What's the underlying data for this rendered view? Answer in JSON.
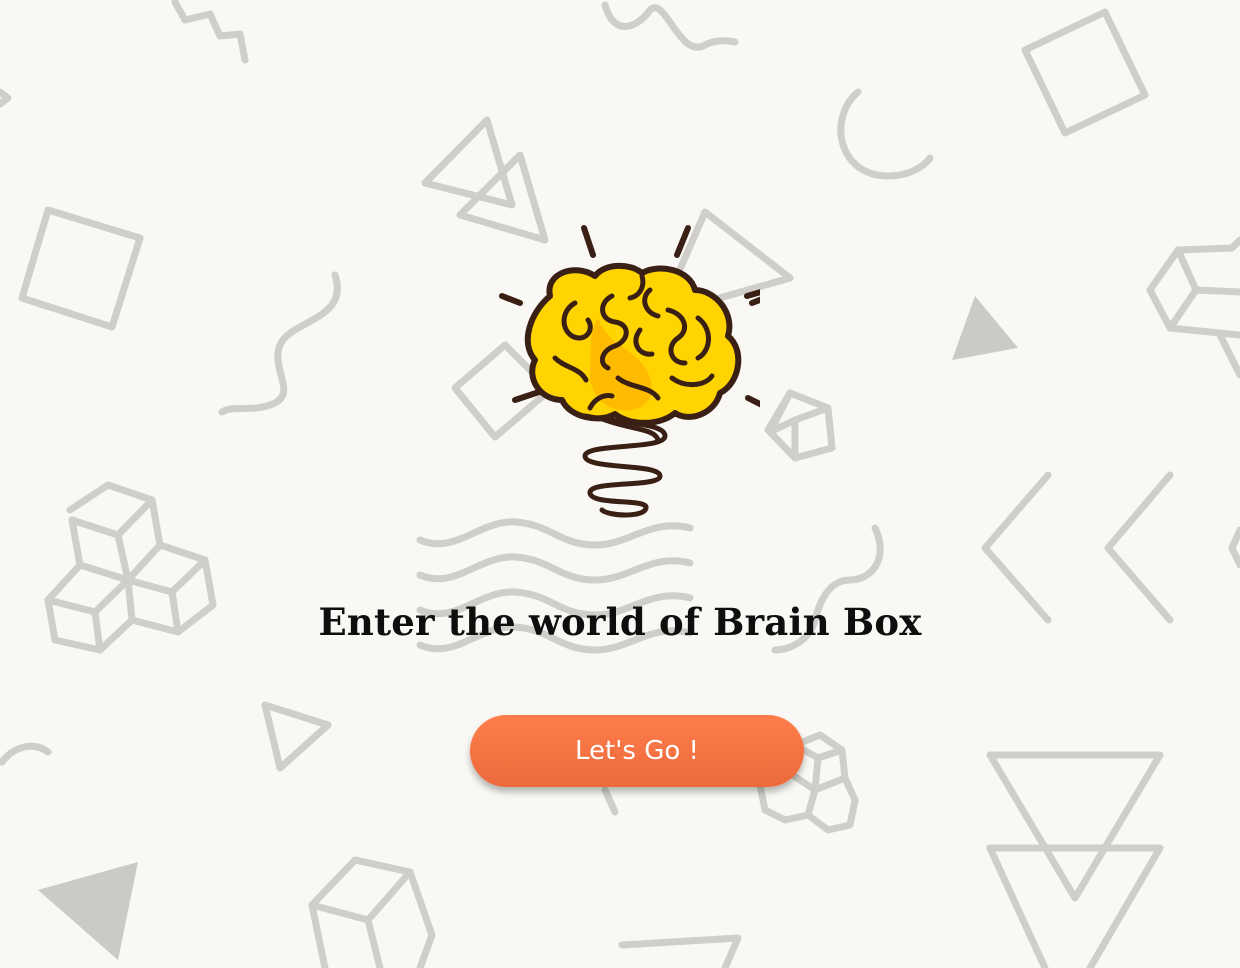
{
  "headline": "Enter the world of Brain Box",
  "cta_button": {
    "label": "Let's Go !"
  },
  "logo": {
    "icon": "brain-lightbulb-icon"
  },
  "colors": {
    "background": "#f9f8f4",
    "pattern": "#cfceca",
    "button": "#f47440",
    "button_text": "#ffffff",
    "headline": "#0e0e0e",
    "brain_yellow": "#ffd400",
    "brain_outline": "#3a1f14"
  }
}
